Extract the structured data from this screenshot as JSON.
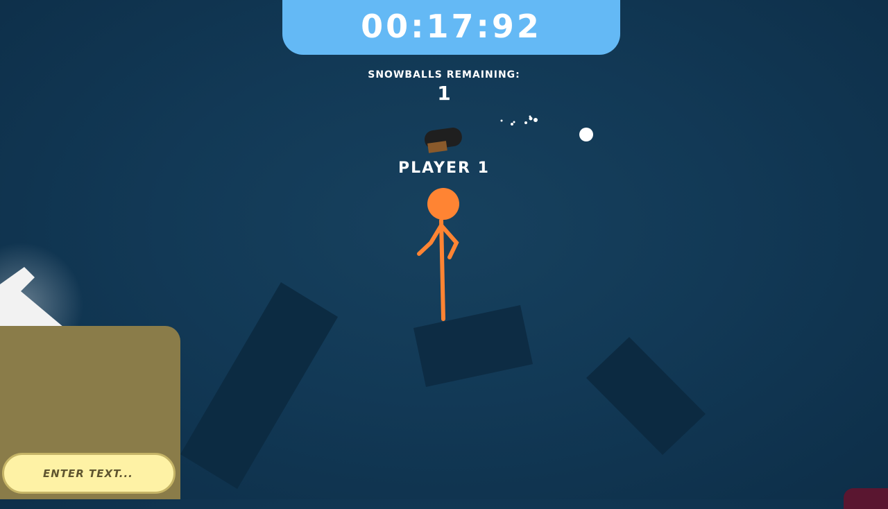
{
  "hud": {
    "timer": "00:17:92",
    "snowballs_label": "SNOWBALLS REMAINING:",
    "snowballs_count": "1",
    "player_name": "PLAYER 1"
  },
  "chat": {
    "placeholder": "ENTER TEXT..."
  },
  "colors": {
    "background": "#123956",
    "timer_panel": "#64b9f5",
    "player": "#ff8433",
    "platform": "#0d2c44",
    "chat_panel": "#8a7c49",
    "chat_input": "#fef2a5"
  }
}
